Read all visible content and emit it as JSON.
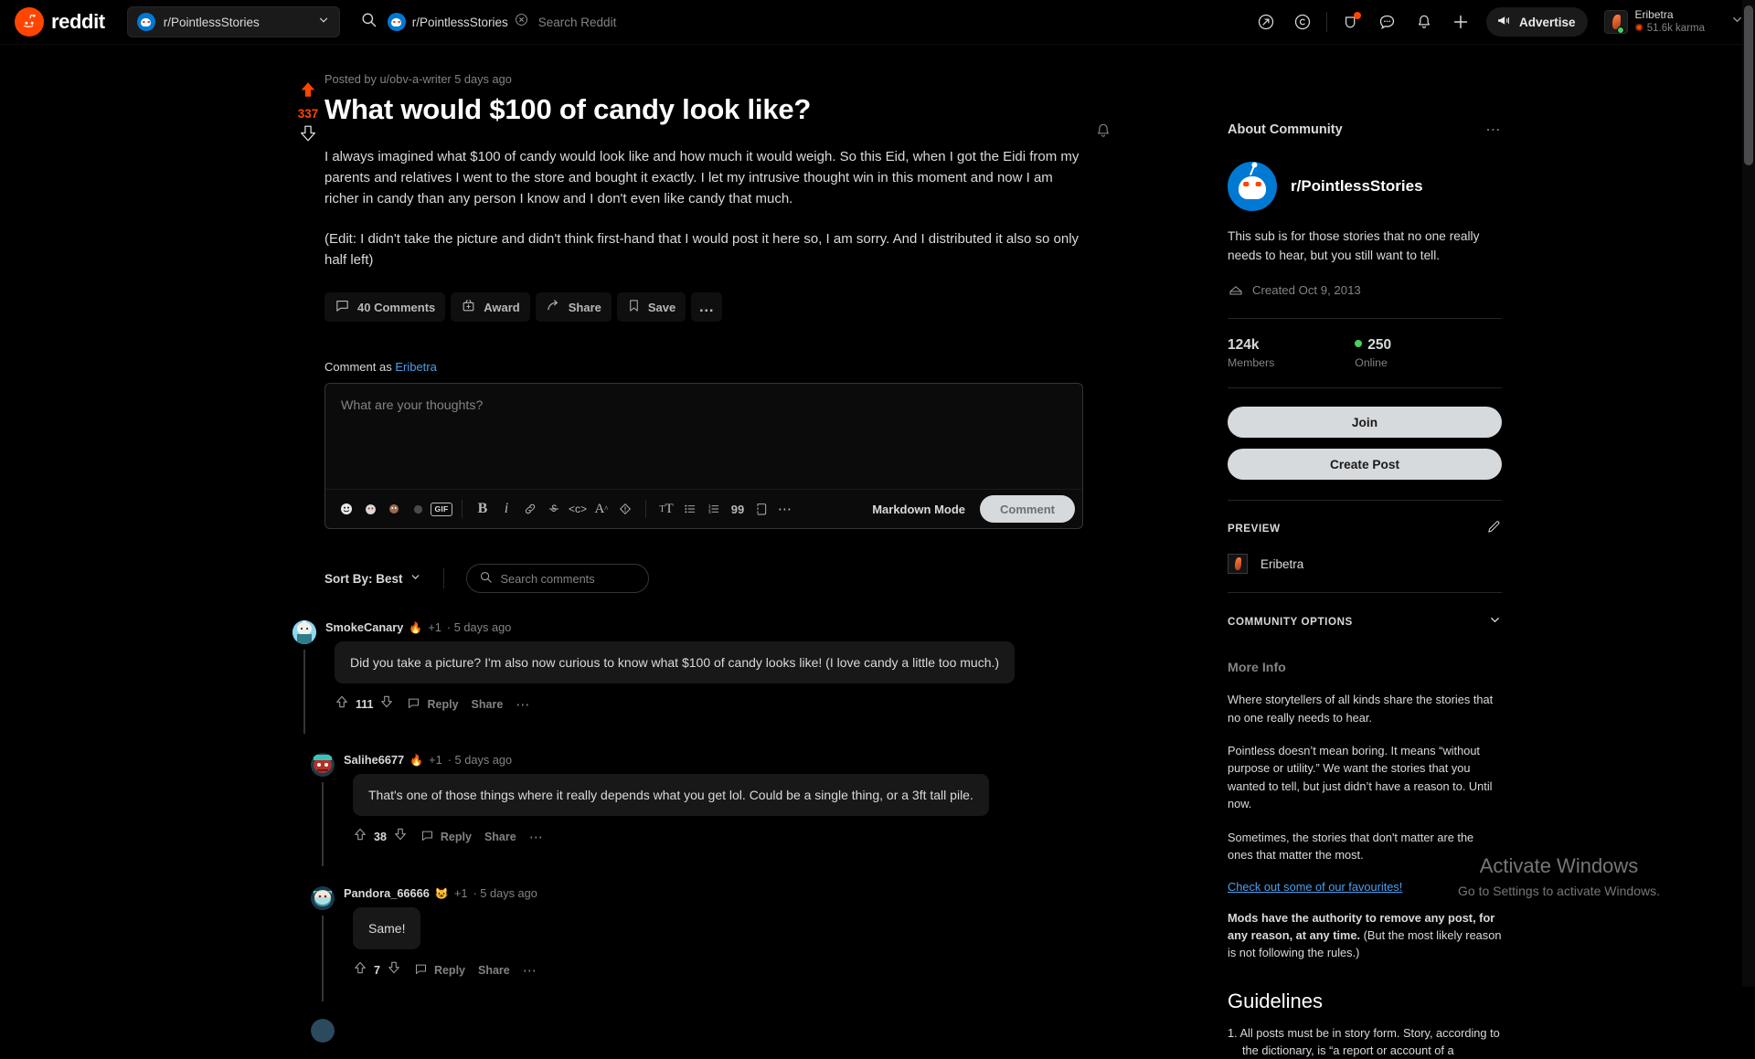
{
  "header": {
    "brand_name": "reddit",
    "sub_switcher": {
      "label": "r/PointlessStories"
    },
    "search": {
      "chip_label": "r/PointlessStories",
      "placeholder": "Search Reddit"
    },
    "advertise_label": "Advertise",
    "user": {
      "name": "Eribetra",
      "karma": "51.6k karma"
    }
  },
  "post": {
    "score": "337",
    "meta": "Posted by u/obv-a-writer 5 days ago",
    "title": "What would $100 of candy look like?",
    "body_p1": "I always imagined what $100 of candy would look like and how much it would weigh. So this Eid, when I got the Eidi from my parents and relatives I went to the store and bought it exactly. I let my intrusive thought win in this moment and now I am richer in candy than any person I know and I don't even like candy that much.",
    "body_p2": "(Edit: I didn't take the picture and didn't think first-hand that I would post it here so, I am sorry. And I distributed it also so only half left)",
    "actions": {
      "comments": "40 Comments",
      "award": "Award",
      "share": "Share",
      "save": "Save",
      "more": "…"
    }
  },
  "composer": {
    "comment_as_prefix": "Comment as ",
    "comment_as_user": "Eribetra",
    "placeholder": "What are your thoughts?",
    "gif_label": "GIF",
    "markdown_mode": "Markdown Mode",
    "submit_label": "Comment"
  },
  "sort": {
    "label": "Sort By: Best",
    "search_placeholder": "Search comments"
  },
  "comments": [
    {
      "user": "SmokeCanary",
      "plus": "+1",
      "time": "5 days ago",
      "text": "Did you take a picture? I'm also now curious to know what $100 of candy looks like! (I love candy a little too much.)",
      "votes": "111",
      "reply": "Reply",
      "share": "Share"
    },
    {
      "user": "Salihe6677",
      "plus": "+1",
      "time": "5 days ago",
      "text": "That's one of those things where it really depends what you get lol. Could be a single thing, or a 3ft tall pile.",
      "votes": "38",
      "reply": "Reply",
      "share": "Share"
    },
    {
      "user": "Pandora_66666",
      "plus": "+1",
      "time": "5 days ago",
      "text": "Same!",
      "votes": "7",
      "reply": "Reply",
      "share": "Share"
    }
  ],
  "sidebar": {
    "about_title": "About Community",
    "community_name": "r/PointlessStories",
    "description": "This sub is for those stories that no one really needs to hear, but you still want to tell.",
    "created": "Created Oct 9, 2013",
    "members_value": "124k",
    "members_label": "Members",
    "online_value": "250",
    "online_label": "Online",
    "join_label": "Join",
    "create_post_label": "Create Post",
    "preview_label": "PREVIEW",
    "preview_user": "Eribetra",
    "community_options_label": "COMMUNITY OPTIONS",
    "more_info_title": "More Info",
    "mi_p1": "Where storytellers of all kinds share the stories that no one really needs to hear.",
    "mi_p2": "Pointless doesn’t mean boring. It means “without purpose or utility.” We want the stories that you wanted to tell, but just didn’t have a reason to. Until now.",
    "mi_p3": "Sometimes, the stories that don't matter are the ones that matter the most.",
    "mi_link": "Check out some of our favourites!",
    "mi_bold": "Mods have the authority to remove any post, for any reason, at any time.",
    "mi_bold_rest": " (But the most likely reason is not following the rules.)",
    "guidelines_title": "Guidelines",
    "guideline_1": "1. All posts must be in story form. Story, according to the dictionary, is “a report or account of a"
  },
  "watermark": {
    "line1": "Activate Windows",
    "line2": "Go to Settings to activate Windows."
  },
  "colors": {
    "accent": "#ff4500",
    "link": "#4f9eed",
    "online": "#46d160",
    "snoo_blue": "#0079d3"
  }
}
